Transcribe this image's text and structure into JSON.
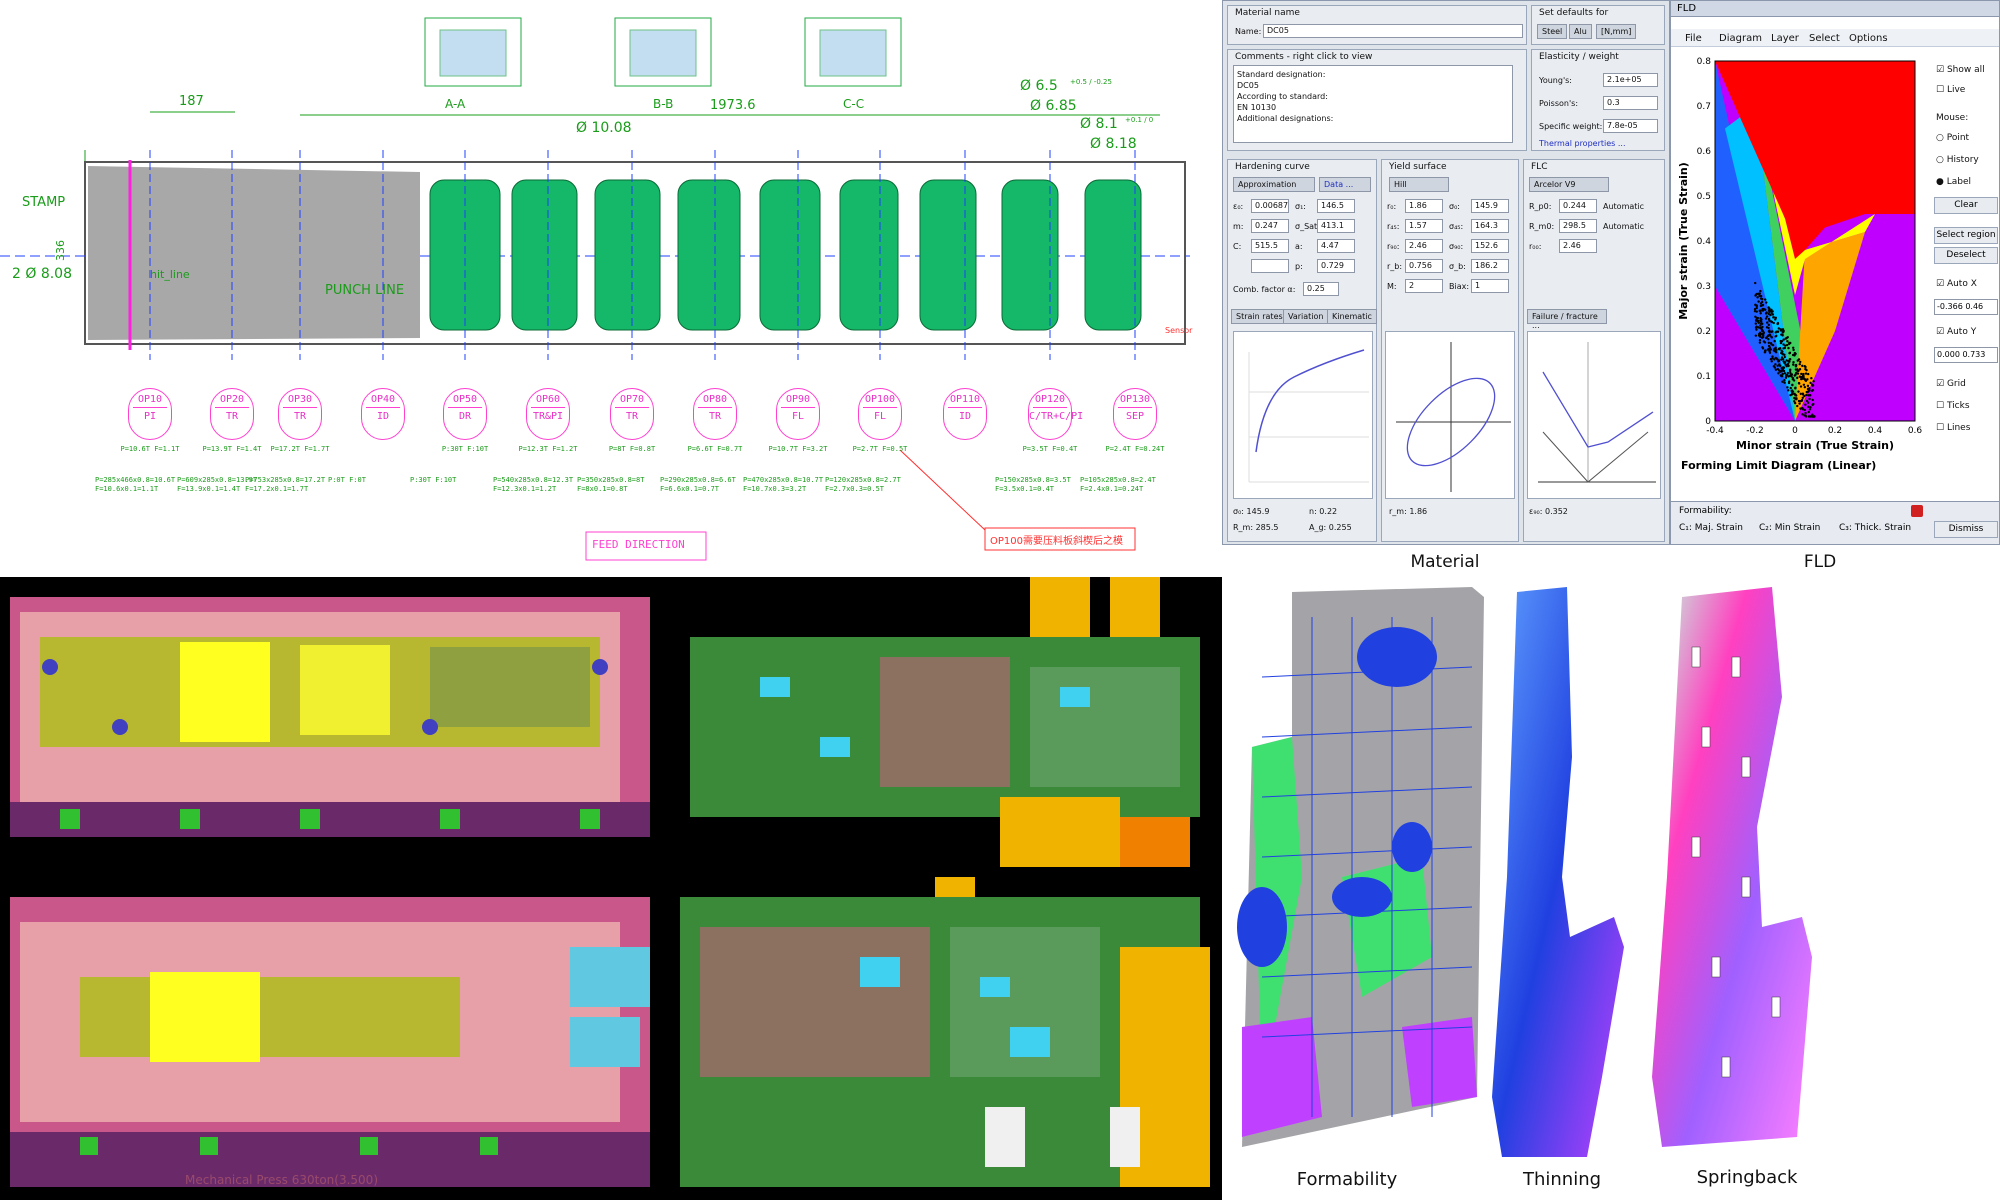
{
  "strip": {
    "dims": {
      "d1": "187",
      "d2": "1973.6",
      "d3": "Ø 10.08",
      "d4": "Ø 6.5",
      "d4tol": "+0.5 / -0.25",
      "d5": "Ø 6.85",
      "d6": "Ø 8.1",
      "d6tol": "+0.1 / 0",
      "d7": "Ø 8.18",
      "left_dim": "2 Ø 8.08",
      "height": "336"
    },
    "sections": [
      "A-A",
      "B-B",
      "C-C"
    ],
    "labels": {
      "stamp": "STAMP",
      "hit_line": "hit_line",
      "punch_line": "PUNCH LINE",
      "sensor": "Sensor",
      "feed": "FEED DIRECTION",
      "note": "OP100需要压料板斜楔后之模"
    },
    "stations": [
      {
        "op": "OP10",
        "type": "PI",
        "force": "P=10.6T F=1.1T",
        "calc": "P=285x466x0.8=10.6T F=10.6x0.1=1.1T"
      },
      {
        "op": "OP20",
        "type": "TR",
        "force": "P=13.9T F=1.4T",
        "calc": "P=609x285x0.8=13.9T F=13.9x0.1=1.4T"
      },
      {
        "op": "OP30",
        "type": "TR",
        "force": "P=17.2T F=1.7T",
        "calc": "P=753x285x0.8=17.2T F=17.2x0.1=1.7T"
      },
      {
        "op": "OP40",
        "type": "ID",
        "force": "",
        "calc": "P:0T F:0T"
      },
      {
        "op": "OP50",
        "type": "DR",
        "force": "P:30T F:10T",
        "calc": "P:30T F:10T"
      },
      {
        "op": "OP60",
        "type": "TR&PI",
        "force": "P=12.3T F=1.2T",
        "calc": "P=540x285x0.8=12.3T F=12.3x0.1=1.2T"
      },
      {
        "op": "OP70",
        "type": "TR",
        "force": "P=8T F=0.8T",
        "calc": "P=350x285x0.8=8T F=8x0.1=0.8T"
      },
      {
        "op": "OP80",
        "type": "TR",
        "force": "P=6.6T F=0.7T",
        "calc": "P=290x285x0.8=6.6T F=6.6x0.1=0.7T"
      },
      {
        "op": "OP90",
        "type": "FL",
        "force": "P=10.7T F=3.2T",
        "calc": "P=470x285x0.8=10.7T F=10.7x0.3=3.2T"
      },
      {
        "op": "OP100",
        "type": "FL",
        "force": "P=2.7T F=0.5T",
        "calc": "P=120x285x0.8=2.7T F=2.7x0.3=0.5T"
      },
      {
        "op": "OP110",
        "type": "ID",
        "force": "",
        "calc": ""
      },
      {
        "op": "OP120",
        "type": "C/TR+C/PI",
        "force": "P=3.5T F=0.4T",
        "calc": "P=150x285x0.8=3.5T F=3.5x0.1=0.4T"
      },
      {
        "op": "OP130",
        "type": "SEP",
        "force": "P=2.4T F=0.24T",
        "calc": "P=105x285x0.8=2.4T F=2.4x0.1=0.24T"
      }
    ]
  },
  "material": {
    "sections": {
      "name_hdr": "Material name",
      "defaults_hdr": "Set defaults for",
      "comments_hdr": "Comments - right click to view",
      "elast_hdr": "Elasticity / weight",
      "hard_hdr": "Hardening curve",
      "yield_hdr": "Yield surface",
      "flc_hdr": "FLC"
    },
    "name_label": "Name:",
    "name_value": "DC05",
    "defaults": [
      "Steel",
      "Alu",
      "[N,mm]"
    ],
    "comments": [
      "Standard designation:",
      "DC05",
      "According to standard:",
      "EN 10130",
      "Additional designations:"
    ],
    "elasticity": [
      {
        "label": "Young's:",
        "value": "2.1e+05"
      },
      {
        "label": "Poisson's:",
        "value": "0.3"
      },
      {
        "label": "Specific weight:",
        "value": "7.8e-05"
      }
    ],
    "thermal": "Thermal properties ...",
    "hardening": {
      "approx": "Approximation",
      "data": "Data ...",
      "rows": [
        {
          "l": "ε₀:",
          "v": "0.00687",
          "l2": "σ₁:",
          "v2": "146.5"
        },
        {
          "l": "m:",
          "v": "0.247",
          "l2": "σ_Sat:",
          "v2": "413.1"
        },
        {
          "l": "C:",
          "v": "515.5",
          "l2": "a:",
          "v2": "4.47"
        },
        {
          "l": "",
          "v": "",
          "l2": "p:",
          "v2": "0.729"
        }
      ],
      "comb_label": "Comb. factor α:",
      "comb_value": "0.25",
      "buttons": [
        "Strain rates",
        "Variation",
        "Kinematic"
      ],
      "footer": [
        "σ₀: 145.9",
        "n: 0.22",
        "R_m: 285.5",
        "A_g: 0.255"
      ]
    },
    "yield": {
      "model": "Hill",
      "rows": [
        {
          "l": "r₀:",
          "v": "1.86",
          "l2": "σ₀:",
          "v2": "145.9"
        },
        {
          "l": "r₄₅:",
          "v": "1.57",
          "l2": "σ₄₅:",
          "v2": "164.3"
        },
        {
          "l": "r₉₀:",
          "v": "2.46",
          "l2": "σ₉₀:",
          "v2": "152.6"
        },
        {
          "l": "r_b:",
          "v": "0.756",
          "l2": "σ_b:",
          "v2": "186.2"
        },
        {
          "l": "M:",
          "v": "2",
          "l2": "Biax:",
          "v2": "1"
        }
      ],
      "footer": "r_m: 1.86"
    },
    "flc": {
      "model": "Arcelor V9",
      "rows": [
        {
          "l": "R_p0:",
          "v": "0.244",
          "chk": "Automatic"
        },
        {
          "l": "R_m0:",
          "v": "298.5",
          "chk": "Automatic"
        },
        {
          "l": "r₀₀:",
          "v": "2.46",
          "chk": ""
        }
      ],
      "failure": "Failure / fracture ...",
      "footer": "ε₉₀: 0.352"
    }
  },
  "fld": {
    "window_title": "FLD",
    "menu": [
      "File",
      "Diagram",
      "Layer",
      "Select",
      "Options"
    ],
    "side": {
      "show_all": "Show all",
      "live": "Live",
      "mouse": "Mouse:",
      "point": "Point",
      "history": "History",
      "label": "Label",
      "clear": "Clear",
      "select_region": "Select region",
      "deselect": "Deselect",
      "auto_x": "Auto X",
      "x_val": "-0.366 0.46",
      "auto_y": "Auto Y",
      "y_val": "0.000 0.733",
      "grid": "Grid",
      "ticks": "Ticks",
      "lines": "Lines",
      "dismiss": "Dismiss"
    },
    "formability": "Formability:",
    "legend": [
      "C₁: Maj. Strain",
      "C₂: Min Strain",
      "C₃: Thick. Strain"
    ],
    "diagram_title": "Forming Limit Diagram (Linear)"
  },
  "captions": {
    "material": "Material",
    "fld": "FLD",
    "formability": "Formability",
    "thinning": "Thinning",
    "springback": "Springback",
    "press": "Mechanical Press 630ton(3.500)"
  },
  "chart_data": {
    "type": "scatter",
    "title": "Forming Limit Diagram (Linear)",
    "xlabel": "Minor strain (True Strain)",
    "ylabel": "Major strain (True Strain)",
    "xlim": [
      -0.4,
      0.6
    ],
    "ylim": [
      0,
      0.8
    ],
    "xticks": [
      "-0.4",
      "-0.2",
      "0",
      "0.2",
      "0.4",
      "0.6"
    ],
    "yticks": [
      "0",
      "0.1",
      "0.2",
      "0.3",
      "0.4",
      "0.5",
      "0.6",
      "0.7",
      "0.8"
    ],
    "flc_curve": {
      "x": [
        -0.4,
        -0.05,
        0.0,
        0.05,
        0.15,
        0.35,
        0.6
      ],
      "y": [
        0.8,
        0.45,
        0.36,
        0.38,
        0.43,
        0.46,
        0.46
      ]
    },
    "zones": [
      {
        "name": "failure",
        "color": "#ff0000"
      },
      {
        "name": "risk",
        "color": "#ffff00"
      },
      {
        "name": "safe-wrinkle",
        "color": "#ffa500"
      },
      {
        "name": "compress",
        "color": "#00c0ff"
      },
      {
        "name": "thickening",
        "color": "#c000ff"
      }
    ],
    "points_cluster": {
      "x_range": [
        -0.2,
        0.1
      ],
      "y_range": [
        0.0,
        0.3
      ],
      "color": "#000000"
    }
  }
}
